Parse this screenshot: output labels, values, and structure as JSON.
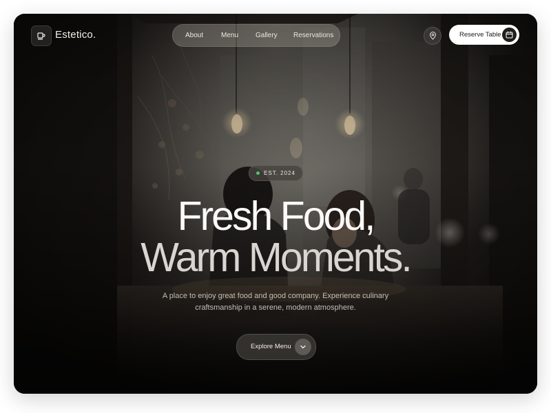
{
  "brand": {
    "name": "Estetico.",
    "logo_icon": "coffee-cup-icon"
  },
  "nav": {
    "items": [
      {
        "label": "About"
      },
      {
        "label": "Menu"
      },
      {
        "label": "Gallery"
      },
      {
        "label": "Reservations"
      }
    ]
  },
  "header": {
    "location_icon": "location-pin-icon",
    "reserve_label": "Reserve Table",
    "reserve_icon": "calendar-icon"
  },
  "hero": {
    "badge": "EST. 2024",
    "badge_dot_color": "#52c46a",
    "title_line1": "Fresh Food,",
    "title_line2": "Warm Moments.",
    "subtitle_line1": "A place to enjoy great food and good company. Experience culinary",
    "subtitle_line2": "craftsmanship in a serene, modern atmosphere.",
    "cta_label": "Explore Menu",
    "cta_icon": "chevron-down-icon"
  },
  "colors": {
    "accent": "#ffffff",
    "background": "#1e1c1a",
    "text": "#fbfaf8"
  }
}
